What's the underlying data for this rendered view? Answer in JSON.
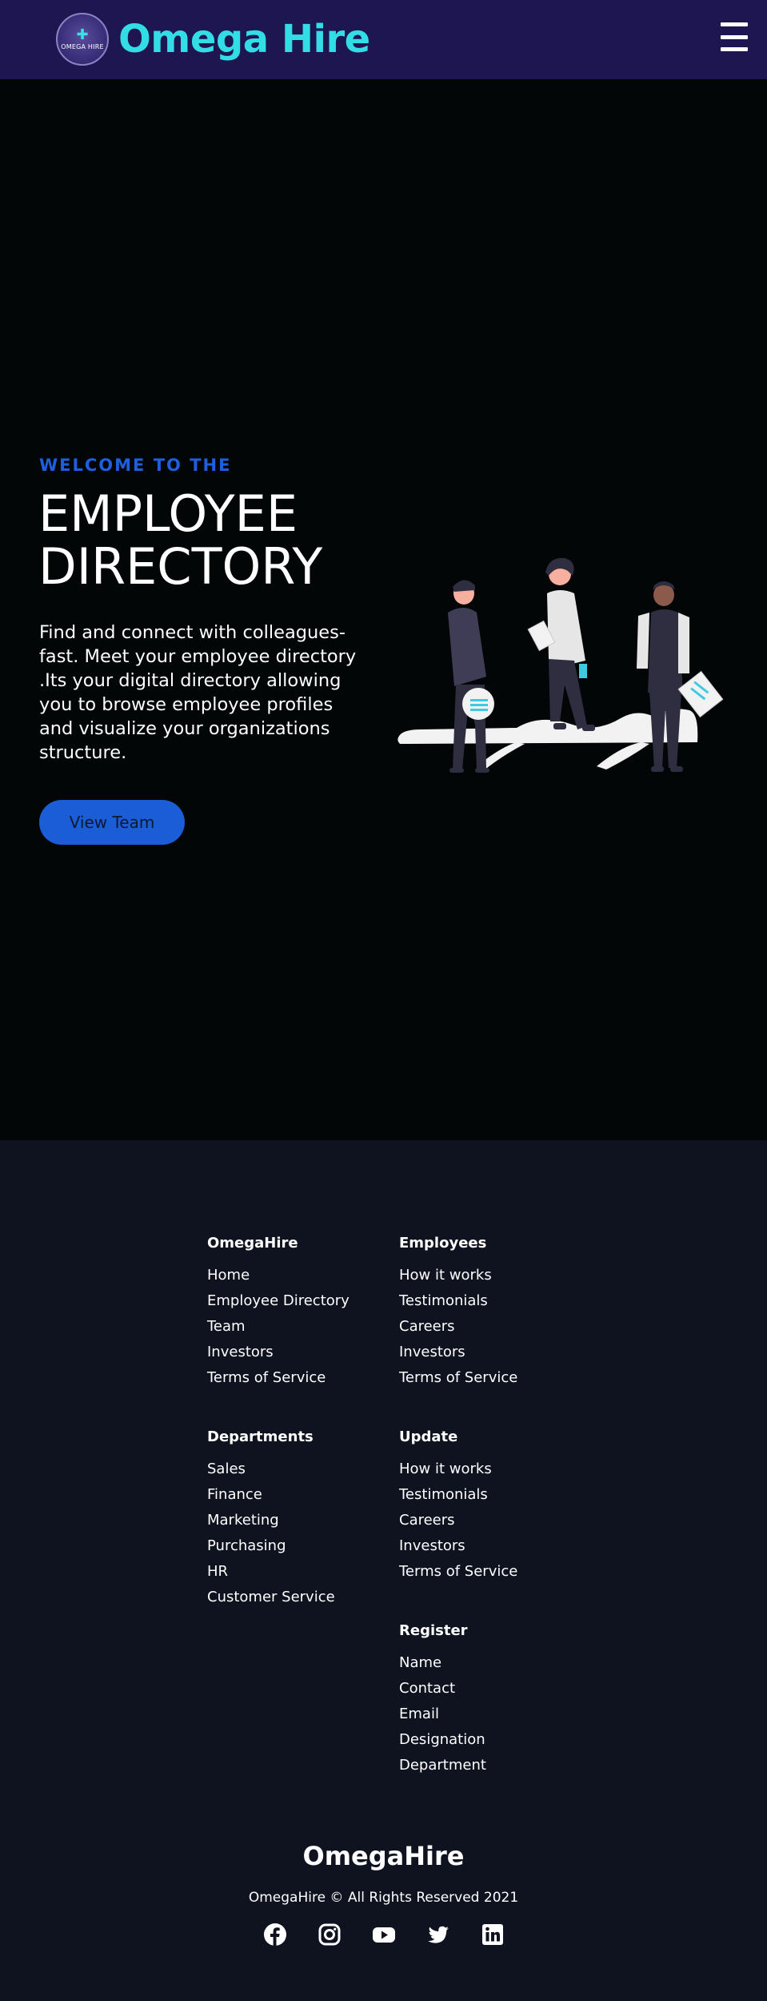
{
  "header": {
    "logo_badge_text": "OMEGA HIRE",
    "brand": "Omega Hire",
    "menu_icon": "hamburger-menu-icon"
  },
  "hero": {
    "eyebrow": "WELCOME TO THE",
    "title_line1": "EMPLOYEE",
    "title_line2": "DIRECTORY",
    "description": "Find and connect with colleagues-fast. Meet your employee directory .Its your digital directory allowing you to browse employee profiles and visualize your organizations structure.",
    "cta": "View Team",
    "illustration": "team-illustration"
  },
  "footer": {
    "columns": [
      {
        "title": "OmegaHire",
        "links": [
          "Home",
          "Employee Directory",
          "Team",
          "Investors",
          "Terms of Service"
        ]
      },
      {
        "title": "Employees",
        "links": [
          "How it works",
          "Testimonials",
          "Careers",
          "Investors",
          "Terms of Service"
        ]
      },
      {
        "title": "Departments",
        "links": [
          "Sales",
          "Finance",
          "Marketing",
          "Purchasing",
          "HR",
          "Customer Service"
        ]
      },
      {
        "title": "Update",
        "links": [
          "How it works",
          "Testimonials",
          "Careers",
          "Investors",
          "Terms of Service"
        ]
      },
      {
        "title": "Register",
        "links": [
          "Name",
          "Contact",
          "Email",
          "Designation",
          "Department"
        ]
      }
    ],
    "brand": "OmegaHire",
    "copyright": "OmegaHire © All Rights Reserved 2021",
    "socials": [
      "facebook-icon",
      "instagram-icon",
      "youtube-icon",
      "twitter-icon",
      "linkedin-icon"
    ]
  },
  "colors": {
    "nav_bg": "#1d1650",
    "brand_text": "#33dde6",
    "hero_bg": "#020606",
    "accent": "#1a5dd6",
    "footer_bg": "#0f1320"
  }
}
